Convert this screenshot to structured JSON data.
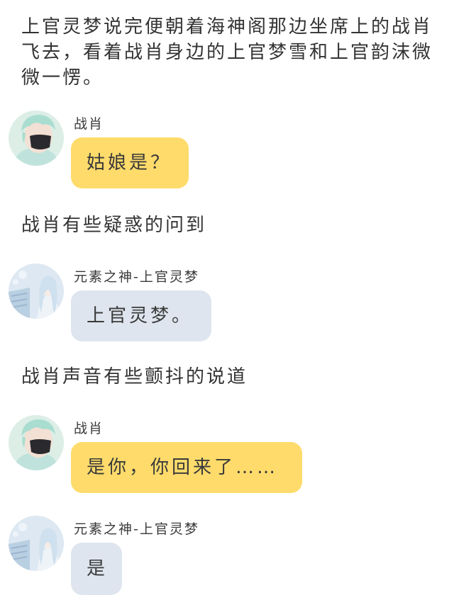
{
  "narrations": [
    "上官灵梦说完便朝着海神阁那边坐席上的战肖飞去，看着战肖身边的上官梦雪和上官韵沫微微一愣。",
    "战肖有些疑惑的问到",
    "战肖声音有些颤抖的说道"
  ],
  "messages": [
    {
      "sender": "战肖",
      "text": "姑娘是？",
      "avatar": "boy-mask-avatar",
      "bubble_color": "#fedb6b"
    },
    {
      "sender": "元素之神-上官灵梦",
      "text": "上官灵梦。",
      "avatar": "anime-girl-avatar",
      "bubble_color": "#dee5ee"
    },
    {
      "sender": "战肖",
      "text": "是你，你回来了……",
      "avatar": "boy-mask-avatar",
      "bubble_color": "#fedb6b"
    },
    {
      "sender": "元素之神-上官灵梦",
      "text": "是",
      "avatar": "anime-girl-avatar",
      "bubble_color": "#dee5ee"
    }
  ]
}
